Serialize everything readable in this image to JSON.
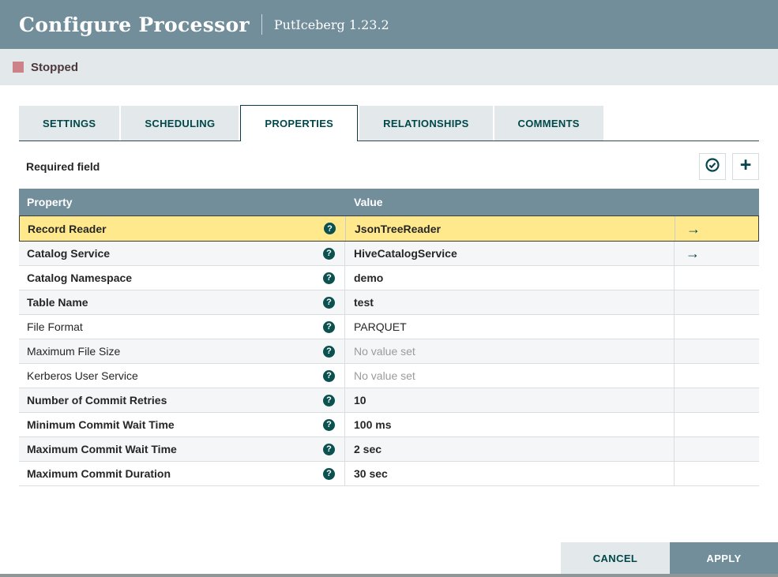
{
  "dialog": {
    "title": "Configure Processor",
    "subtitle": "PutIceberg 1.23.2"
  },
  "status": {
    "label": "Stopped",
    "color": "#cd8287"
  },
  "tabs": [
    {
      "label": "SETTINGS",
      "active": false
    },
    {
      "label": "SCHEDULING",
      "active": false
    },
    {
      "label": "PROPERTIES",
      "active": true
    },
    {
      "label": "RELATIONSHIPS",
      "active": false
    },
    {
      "label": "COMMENTS",
      "active": false
    }
  ],
  "toolbar": {
    "required_field_label": "Required field",
    "verify_icon": "check-circle-icon",
    "add_icon": "plus-icon",
    "add_glyph": "+"
  },
  "icons": {
    "help_glyph": "?",
    "go_to_glyph": "→"
  },
  "table": {
    "columns": [
      "Property",
      "Value"
    ],
    "rows": [
      {
        "property": "Record Reader",
        "value": "JsonTreeReader",
        "required": true,
        "selected": true,
        "unset": false,
        "has_link": true
      },
      {
        "property": "Catalog Service",
        "value": "HiveCatalogService",
        "required": true,
        "selected": false,
        "unset": false,
        "has_link": true
      },
      {
        "property": "Catalog Namespace",
        "value": "demo",
        "required": true,
        "selected": false,
        "unset": false,
        "has_link": false
      },
      {
        "property": "Table Name",
        "value": "test",
        "required": true,
        "selected": false,
        "unset": false,
        "has_link": false
      },
      {
        "property": "File Format",
        "value": "PARQUET",
        "required": false,
        "selected": false,
        "unset": false,
        "has_link": false
      },
      {
        "property": "Maximum File Size",
        "value": "No value set",
        "required": false,
        "selected": false,
        "unset": true,
        "has_link": false
      },
      {
        "property": "Kerberos User Service",
        "value": "No value set",
        "required": false,
        "selected": false,
        "unset": true,
        "has_link": false
      },
      {
        "property": "Number of Commit Retries",
        "value": "10",
        "required": true,
        "selected": false,
        "unset": false,
        "has_link": false
      },
      {
        "property": "Minimum Commit Wait Time",
        "value": "100 ms",
        "required": true,
        "selected": false,
        "unset": false,
        "has_link": false
      },
      {
        "property": "Maximum Commit Wait Time",
        "value": "2 sec",
        "required": true,
        "selected": false,
        "unset": false,
        "has_link": false
      },
      {
        "property": "Maximum Commit Duration",
        "value": "30 sec",
        "required": true,
        "selected": false,
        "unset": false,
        "has_link": false
      }
    ]
  },
  "footer": {
    "cancel_label": "CANCEL",
    "apply_label": "APPLY"
  },
  "colors": {
    "header_slate": "#728e9b",
    "accent_teal": "#004849",
    "selected_row": "#ffe98c",
    "alt_row": "#f4f6f7",
    "light_gray": "#e3e8eb"
  }
}
